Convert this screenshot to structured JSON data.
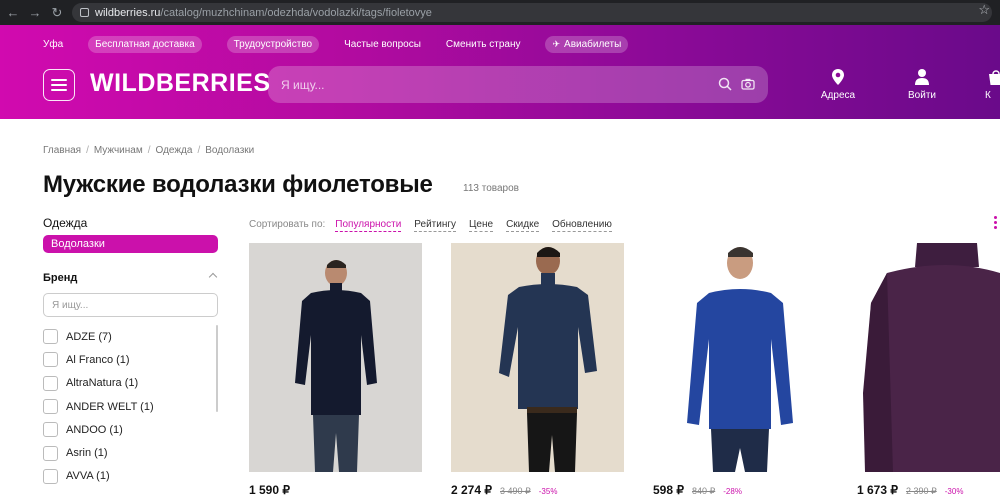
{
  "browser": {
    "url_host": "wildberries.ru",
    "url_path": "/catalog/muzhchinam/odezhda/vodolazki/tags/fioletovye"
  },
  "header": {
    "city": "Уфа",
    "links": [
      "Бесплатная доставка",
      "Трудоустройство",
      "Частые вопросы",
      "Сменить страну",
      "Авиабилеты"
    ],
    "logo": "WILDBERRIES",
    "search_placeholder": "Я ищу...",
    "actions": {
      "address": "Адреса",
      "login": "Войти",
      "cart_partial": "К"
    }
  },
  "breadcrumb": [
    "Главная",
    "Мужчинам",
    "Одежда",
    "Водолазки"
  ],
  "page_title": "Мужские водолазки фиолетовые",
  "product_count": "113 товаров",
  "sidebar": {
    "category_title": "Одежда",
    "category_active": "Водолазки",
    "brand_title": "Бренд",
    "brand_search_placeholder": "Я ищу...",
    "brands": [
      "ADZE (7)",
      "Al Franco (1)",
      "AltraNatura (1)",
      "ANDER WELT (1)",
      "ANDOO (1)",
      "Asrin (1)",
      "AVVA (1)"
    ]
  },
  "sort": {
    "label": "Сортировать по:",
    "options": [
      "Популярности",
      "Рейтингу",
      "Цене",
      "Скидке",
      "Обновлению"
    ]
  },
  "products": [
    {
      "price": "1 590 ₽",
      "old_price": "",
      "discount": ""
    },
    {
      "price": "2 274 ₽",
      "old_price": "3 490 ₽",
      "discount": "-35%"
    },
    {
      "price": "598 ₽",
      "old_price": "840 ₽",
      "discount": "-28%"
    },
    {
      "price": "1 673 ₽",
      "old_price": "2 390 ₽",
      "discount": "-30%"
    }
  ],
  "colors": {
    "brand_magenta": "#cb11ab",
    "header_gradient_start": "#d10aaf",
    "header_gradient_end": "#6a0a8a"
  }
}
